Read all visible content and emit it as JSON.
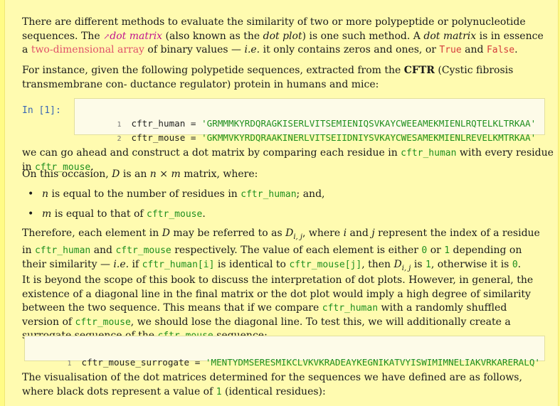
{
  "p1": {
    "a": "There are different methods to evaluate the similarity of two or more polypeptide or polynucleotide sequences. The",
    "link_icon": "external-link-icon",
    "link": "dot matrix",
    "b": "(also known as the",
    "c": "dot plot",
    "d": ") is one such method.  A",
    "e": "dot matrix",
    "f": "is in essence a",
    "g": "two-dimensional array",
    "h": "of binary values —",
    "i": "i.e.",
    "j": "it only contains zeros and ones, or",
    "k": "True",
    "l": "and",
    "m": "False",
    "n": "."
  },
  "p2": {
    "a": "For instance, given the following polypetide sequences, extracted from the",
    "b": "CFTR",
    "c": "(Cystic fibrosis transmembrane con-",
    "d": "ductance regulator) protein in humans and mice:"
  },
  "cell1": {
    "prompt": "In [1]:",
    "lines": [
      {
        "n": "1",
        "var": "cftr_human",
        "op": " = ",
        "str": "'GRMMMKYRDQRAGKISERLVITSEMIENIQSVKAYCWEEAMEKMIENLRQTELKLTRKAA'"
      },
      {
        "n": "2",
        "var": "cftr_mouse",
        "op": " = ",
        "str": "'GKMMVKYRDQRAAKINERLVITSEIIDNIYSVKAYCWESAMEKMIENLREVELKMTRKAA'"
      }
    ]
  },
  "p3": {
    "a": "we can go ahead and construct a dot matrix by comparing each residue in",
    "b": "cftr_human",
    "c": "with every residue in",
    "d": "cftr_mouse",
    "e": "."
  },
  "p4": {
    "a": "On this occasion,",
    "b": "D",
    "c": "is an",
    "d": "n × m",
    "e": "matrix, where:"
  },
  "bullets": [
    {
      "var": "n",
      "a": "is equal to the number of residues in",
      "code": "cftr_human",
      "b": "; and,"
    },
    {
      "var": "m",
      "a": "is equal to that of",
      "code": "cftr_mouse",
      "b": "."
    }
  ],
  "p5": {
    "a": "Therefore, each element in",
    "b": "D",
    "c": "may be referred to as",
    "d": "D",
    "d_sub": "i, j",
    "e": ", where",
    "f": "i",
    "g": "and",
    "h": "j",
    "i": "represent the index of a residue in",
    "j": "cftr_human",
    "k": "and",
    "l": "cftr_mouse",
    "m": "respectively. The value of each element is either",
    "n": "0",
    "o": "or",
    "p": "1",
    "q": "depending on their similarity —",
    "r": "i.e.",
    "s": "if",
    "t": "cftr_human[i]",
    "u": "is identical to",
    "v": "cftr_mouse[j]",
    "w": ", then",
    "x": "D",
    "x_sub": "i, j",
    "y": "is",
    "z": "1",
    "aa": ", otherwise it is",
    "ab": "0",
    "ac": "."
  },
  "p6": {
    "a": "It is beyond the scope of this book to discuss the interpretation of dot plots.  However, in general, the existence of a diagonal line in the final matrix or the dot plot would imply a high degree of similarity between the two sequence. This means that if we compare",
    "b": "cftr_human",
    "c": "with a randomly shuffled version of",
    "d": "cftr_mouse",
    "e": ", we should lose the diagonal line. To test this, we will additionally create a surrogate sequence of the",
    "f": "cftr_mouse",
    "g": "sequence:"
  },
  "cell2": {
    "lines": [
      {
        "n": "1",
        "var": "cftr_mouse_surrogate",
        "op": " = ",
        "str": "'MENTYDMSERESMIKCLVKVKRADEAYKEGNIKATVYISWIMIMNELIAKVRKARERALQ'"
      }
    ]
  },
  "p7": {
    "a": "The visualisation of the dot matrices determined for the sequences we have defined are as follows, where black dots represent a value of",
    "b": "1",
    "c": "(identical residues):"
  }
}
